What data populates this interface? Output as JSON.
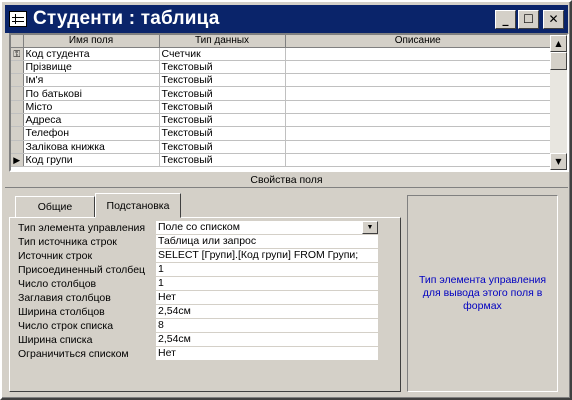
{
  "window": {
    "title": "Студенти : таблица",
    "buttons": {
      "minimize": "_",
      "maximize": "☐",
      "close": "✕"
    }
  },
  "grid": {
    "headers": [
      "Имя поля",
      "Тип данных",
      "Описание"
    ],
    "rows": [
      {
        "name": "Код студента",
        "type": "Счетчик",
        "desc": "",
        "key": true
      },
      {
        "name": "Прізвище",
        "type": "Текстовый",
        "desc": ""
      },
      {
        "name": "Ім'я",
        "type": "Текстовый",
        "desc": ""
      },
      {
        "name": "По батькові",
        "type": "Текстовый",
        "desc": ""
      },
      {
        "name": "Місто",
        "type": "Текстовый",
        "desc": ""
      },
      {
        "name": "Адреса",
        "type": "Текстовый",
        "desc": ""
      },
      {
        "name": "Телефон",
        "type": "Текстовый",
        "desc": ""
      },
      {
        "name": "Залікова книжка",
        "type": "Текстовый",
        "desc": ""
      },
      {
        "name": "Код групи",
        "type": "Текстовый",
        "desc": "",
        "current": true
      }
    ]
  },
  "properties": {
    "title": "Свойства поля",
    "tabs": [
      "Общие",
      "Подстановка"
    ],
    "active_tab": "Подстановка",
    "rows": [
      {
        "label": "Тип элемента управления",
        "value": "Поле со списком",
        "dropdown": true
      },
      {
        "label": "Тип источника строк",
        "value": "Таблица или запрос"
      },
      {
        "label": "Источник строк",
        "value": "SELECT [Групи].[Код групи] FROM Групи;"
      },
      {
        "label": "Присоединенный столбец",
        "value": "1"
      },
      {
        "label": "Число столбцов",
        "value": "1"
      },
      {
        "label": "Заглавия столбцов",
        "value": "Нет"
      },
      {
        "label": "Ширина столбцов",
        "value": "2,54см"
      },
      {
        "label": "Число строк списка",
        "value": "8"
      },
      {
        "label": "Ширина списка",
        "value": "2,54см"
      },
      {
        "label": "Ограничиться списком",
        "value": "Нет"
      }
    ],
    "help_text": "Тип элемента управления для вывода этого поля в формах"
  }
}
